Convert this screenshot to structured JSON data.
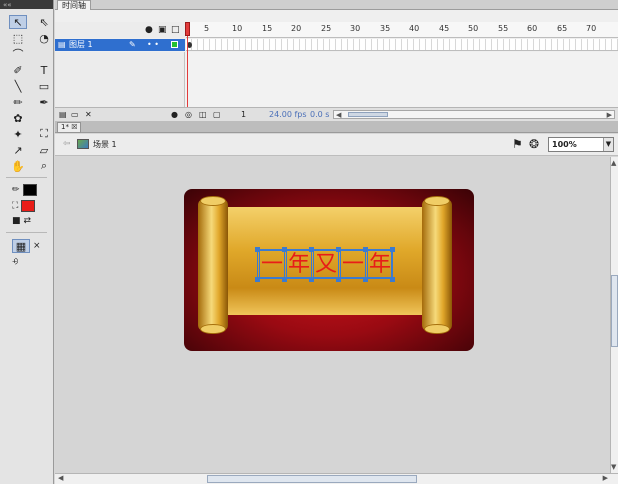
{
  "timeline": {
    "tab_label": "时间轴",
    "ruler_ticks": [
      "5",
      "10",
      "15",
      "20",
      "25",
      "30",
      "35",
      "40",
      "45",
      "50",
      "55",
      "60",
      "65",
      "70"
    ],
    "layer": {
      "name": "图层 1"
    },
    "status": {
      "frame": "1",
      "fps": "24.00 fps",
      "time": "0.0 s"
    }
  },
  "document": {
    "tab_label": "1*"
  },
  "editbar": {
    "scene": "场景 1",
    "zoom": "100%"
  },
  "stage": {
    "text_chars": [
      "一",
      "年",
      "又",
      "一",
      "年"
    ],
    "text_color": "#e81d18",
    "background_color": "#b0101a"
  },
  "tools": {
    "stroke_color": "#000000",
    "fill_color": "#e81d18"
  }
}
